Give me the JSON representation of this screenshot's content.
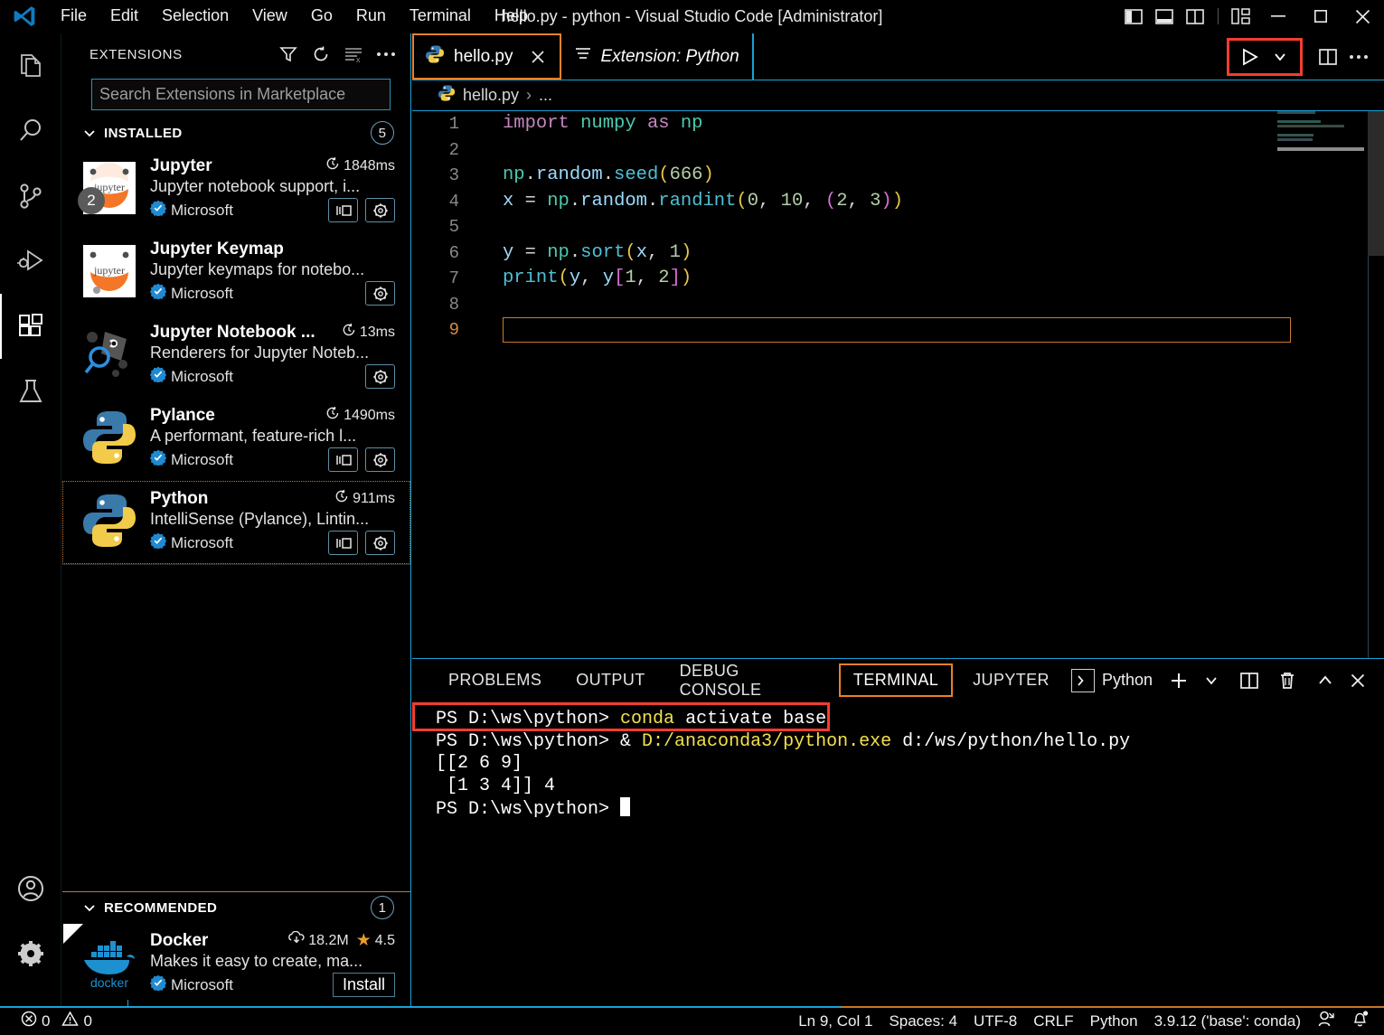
{
  "window": {
    "title": "hello.py - python - Visual Studio Code [Administrator]",
    "menu": [
      "File",
      "Edit",
      "Selection",
      "View",
      "Go",
      "Run",
      "Terminal",
      "Help"
    ],
    "layout_buttons": [
      {
        "name": "toggle-primary-sidebar",
        "label": "Toggle Primary Side Bar"
      },
      {
        "name": "toggle-panel",
        "label": "Toggle Panel"
      },
      {
        "name": "toggle-secondary-sidebar",
        "label": "Toggle Secondary Side Bar"
      },
      {
        "name": "customize-layout",
        "label": "Customize Layout"
      }
    ],
    "controls": [
      "minimize",
      "maximize",
      "close"
    ]
  },
  "activitybar": {
    "items": [
      {
        "name": "explorer",
        "label": "Explorer",
        "active": false
      },
      {
        "name": "search",
        "label": "Search",
        "active": false
      },
      {
        "name": "source-control",
        "label": "Source Control",
        "active": false
      },
      {
        "name": "run-and-debug",
        "label": "Run and Debug",
        "active": false
      },
      {
        "name": "extensions",
        "label": "Extensions",
        "active": true
      },
      {
        "name": "testing",
        "label": "Testing",
        "active": false
      }
    ],
    "bottom": [
      {
        "name": "accounts",
        "label": "Accounts"
      },
      {
        "name": "manage-settings",
        "label": "Manage"
      }
    ]
  },
  "sidebar": {
    "title": "EXTENSIONS",
    "actions": [
      {
        "name": "filter-extensions",
        "label": "Filter Extensions"
      },
      {
        "name": "refresh",
        "label": "Refresh"
      },
      {
        "name": "clear-search-results",
        "label": "Clear Extensions Search Results"
      },
      {
        "name": "views-and-more-actions",
        "label": "Views and More Actions..."
      }
    ],
    "search": {
      "placeholder": "Search Extensions in Marketplace",
      "value": ""
    },
    "installed": {
      "label": "INSTALLED",
      "count": "5",
      "items": [
        {
          "name": "Jupyter",
          "description": "Jupyter notebook support, i...",
          "publisher": "Microsoft",
          "meta": "1848ms",
          "meta_icon": "history-icon",
          "badge": "2",
          "has_prerelease_btn": true,
          "has_gear": true,
          "selected": false
        },
        {
          "name": "Jupyter Keymap",
          "description": "Jupyter keymaps for notebo...",
          "publisher": "Microsoft",
          "meta": "",
          "meta_icon": "",
          "badge": "",
          "has_prerelease_btn": false,
          "has_gear": true,
          "selected": false
        },
        {
          "name": "Jupyter Notebook ...",
          "description": "Renderers for Jupyter Noteb...",
          "publisher": "Microsoft",
          "meta": "13ms",
          "meta_icon": "history-icon",
          "badge": "",
          "has_prerelease_btn": false,
          "has_gear": true,
          "selected": false
        },
        {
          "name": "Pylance",
          "description": "A performant, feature-rich l...",
          "publisher": "Microsoft",
          "meta": "1490ms",
          "meta_icon": "history-icon",
          "badge": "",
          "has_prerelease_btn": true,
          "has_gear": true,
          "selected": false
        },
        {
          "name": "Python",
          "description": "IntelliSense (Pylance), Lintin...",
          "publisher": "Microsoft",
          "meta": "911ms",
          "meta_icon": "history-icon",
          "badge": "",
          "has_prerelease_btn": true,
          "has_gear": true,
          "selected": true
        }
      ]
    },
    "recommended": {
      "label": "RECOMMENDED",
      "count": "1",
      "items": [
        {
          "name": "Docker",
          "description": "Makes it easy to create, ma...",
          "publisher": "Microsoft",
          "installs": "18.2M",
          "rating": "4.5",
          "install_label": "Install"
        }
      ]
    }
  },
  "editor": {
    "tabs": [
      {
        "label": "hello.py",
        "icon": "python-file-icon",
        "active": true,
        "closable": true,
        "annotated": true
      },
      {
        "label": "Extension: Python",
        "icon": "extension-page-icon",
        "active": false,
        "closable": false,
        "annotated": false
      }
    ],
    "toolbar": [
      {
        "name": "run-python-file",
        "label": "Run Python File",
        "annotated": true
      },
      {
        "name": "run-dropdown",
        "label": "Run or Debug...",
        "annotated": true
      },
      {
        "name": "split-editor",
        "label": "Split Editor Right",
        "annotated": false
      },
      {
        "name": "more-actions",
        "label": "More Actions...",
        "annotated": false
      }
    ],
    "breadcrumb": [
      "hello.py",
      "..."
    ],
    "lines": [
      {
        "n": "1",
        "text": "import numpy as np",
        "current": false
      },
      {
        "n": "2",
        "text": "",
        "current": false
      },
      {
        "n": "3",
        "text": "np.random.seed(666)",
        "current": false
      },
      {
        "n": "4",
        "text": "x = np.random.randint(0, 10, (2, 3))",
        "current": false
      },
      {
        "n": "5",
        "text": "",
        "current": false
      },
      {
        "n": "6",
        "text": "y = np.sort(x, 1)",
        "current": false
      },
      {
        "n": "7",
        "text": "print(y, y[1, 2])",
        "current": false
      },
      {
        "n": "8",
        "text": "",
        "current": false
      },
      {
        "n": "9",
        "text": "",
        "current": true
      }
    ]
  },
  "panel": {
    "tabs": [
      {
        "label": "PROBLEMS",
        "active": false,
        "annotated": false
      },
      {
        "label": "OUTPUT",
        "active": false,
        "annotated": false
      },
      {
        "label": "DEBUG CONSOLE",
        "active": false,
        "annotated": false
      },
      {
        "label": "TERMINAL",
        "active": true,
        "annotated": true
      },
      {
        "label": "JUPYTER",
        "active": false,
        "annotated": false
      }
    ],
    "terminal_selector": "Python",
    "actions": [
      {
        "name": "new-terminal",
        "label": "New Terminal"
      },
      {
        "name": "terminal-profile-dropdown",
        "label": "Launch Profile..."
      },
      {
        "name": "split-terminal",
        "label": "Split Terminal"
      },
      {
        "name": "kill-terminal",
        "label": "Kill Terminal"
      },
      {
        "name": "maximize-panel",
        "label": "Maximize Panel Size"
      },
      {
        "name": "close-panel",
        "label": "Close Panel"
      }
    ],
    "terminal_lines": [
      {
        "segments": [
          {
            "t": "PS D:\\ws\\python> ",
            "c": "white"
          },
          {
            "t": "conda",
            "c": "yellow"
          },
          {
            "t": " activate base",
            "c": "white"
          }
        ],
        "annotated": true
      },
      {
        "segments": [
          {
            "t": "PS D:\\ws\\python> & ",
            "c": "white"
          },
          {
            "t": "D:/anaconda3/python.exe",
            "c": "yellow"
          },
          {
            "t": " d:/ws/python/hello.py",
            "c": "white"
          }
        ],
        "annotated": false
      },
      {
        "segments": [
          {
            "t": "[[2 6 9]",
            "c": "white"
          }
        ],
        "annotated": false
      },
      {
        "segments": [
          {
            "t": " [1 3 4]] 4",
            "c": "white"
          }
        ],
        "annotated": false
      },
      {
        "segments": [
          {
            "t": "PS D:\\ws\\python> ",
            "c": "white"
          }
        ],
        "annotated": false,
        "cursor": true
      }
    ]
  },
  "statusbar": {
    "left": [
      {
        "name": "problems-errors",
        "icon": "error-circle-icon",
        "label": "0"
      },
      {
        "name": "problems-warnings",
        "icon": "warning-triangle-icon",
        "label": "0"
      }
    ],
    "right": [
      {
        "name": "editor-position",
        "label": "Ln 9, Col 1"
      },
      {
        "name": "editor-indentation",
        "label": "Spaces: 4"
      },
      {
        "name": "editor-encoding",
        "label": "UTF-8"
      },
      {
        "name": "editor-eol",
        "label": "CRLF"
      },
      {
        "name": "editor-language",
        "label": "Python"
      },
      {
        "name": "python-interpreter",
        "label": "3.9.12 ('base': conda)"
      },
      {
        "name": "remote-indicator",
        "label": ""
      },
      {
        "name": "notifications-bell",
        "label": ""
      }
    ]
  },
  "colors": {
    "accent_blue": "#16a3d8",
    "annotation_red": "#f43d2e",
    "annotation_orange": "#e8812b",
    "terminal_yellow": "#f3e14b",
    "badge_gray": "#5a5a5a"
  }
}
